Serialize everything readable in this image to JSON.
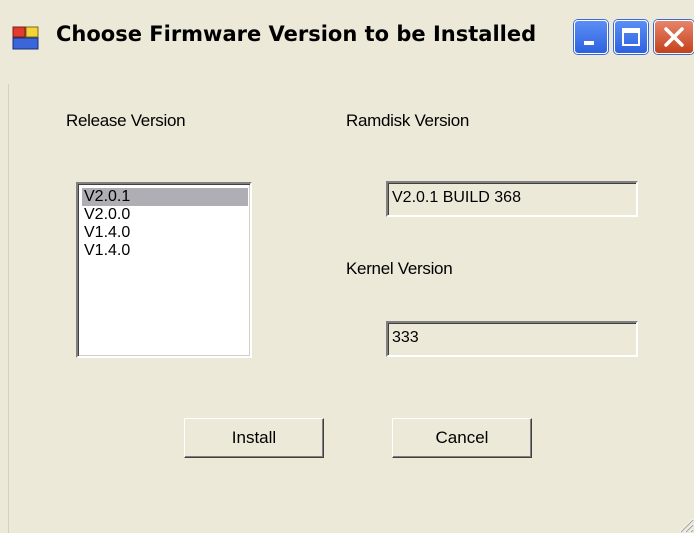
{
  "window": {
    "title": "Choose Firmware Version to be Installed"
  },
  "labels": {
    "release": "Release Version",
    "ramdisk": "Ramdisk Version",
    "kernel": "Kernel Version"
  },
  "release_list": {
    "items": [
      "V2.0.1",
      "V2.0.0",
      "V1.4.0",
      "V1.4.0"
    ],
    "selected_index": 0
  },
  "fields": {
    "ramdisk_value": "V2.0.1 BUILD 368",
    "kernel_value": "333"
  },
  "buttons": {
    "install": "Install",
    "cancel": "Cancel"
  },
  "icons": {
    "app": "window-app-icon",
    "minimize": "minimize-icon",
    "maximize": "maximize-icon",
    "close": "close-icon",
    "grip": "resize-grip-icon"
  },
  "colors": {
    "face": "#ece9d8",
    "selection": "#aeaeb4",
    "close_red": "#d2532c",
    "title_blue": "#2d62e0"
  }
}
